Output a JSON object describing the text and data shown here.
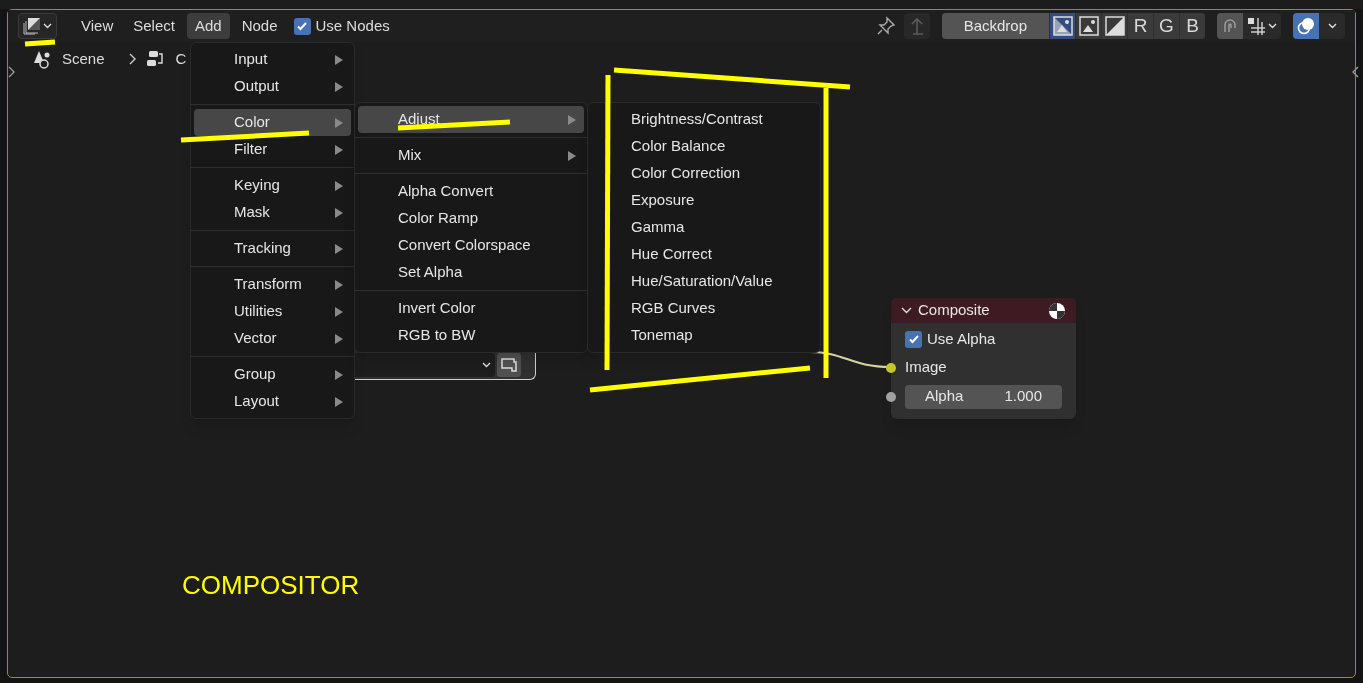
{
  "header": {
    "menus": [
      {
        "label": "View",
        "selected": false
      },
      {
        "label": "Select",
        "selected": false
      },
      {
        "label": "Add",
        "selected": true
      },
      {
        "label": "Node",
        "selected": false
      }
    ],
    "use_nodes": {
      "label": "Use Nodes",
      "checked": true
    },
    "backdrop": {
      "label": "Backdrop",
      "modes": [
        {
          "kind": "color_alpha",
          "selected": true
        },
        {
          "kind": "color",
          "selected": false
        },
        {
          "kind": "alpha",
          "selected": false
        },
        {
          "kind": "channel",
          "label": "R",
          "selected": false
        },
        {
          "kind": "channel",
          "label": "G",
          "selected": false
        },
        {
          "kind": "channel",
          "label": "B",
          "selected": false
        }
      ]
    },
    "snap": {
      "on": true
    },
    "overlays": {
      "on": true
    }
  },
  "breadcrumb": [
    "Scene",
    "C"
  ],
  "add_menu": [
    [
      {
        "label": "Input",
        "submenu": true,
        "selected": false
      },
      {
        "label": "Output",
        "submenu": true,
        "selected": false
      }
    ],
    [
      {
        "label": "Color",
        "submenu": true,
        "selected": true
      },
      {
        "label": "Filter",
        "submenu": true,
        "selected": false
      }
    ],
    [
      {
        "label": "Keying",
        "submenu": true,
        "selected": false
      },
      {
        "label": "Mask",
        "submenu": true,
        "selected": false
      }
    ],
    [
      {
        "label": "Tracking",
        "submenu": true,
        "selected": false
      }
    ],
    [
      {
        "label": "Transform",
        "submenu": true,
        "selected": false
      },
      {
        "label": "Utilities",
        "submenu": true,
        "selected": false
      },
      {
        "label": "Vector",
        "submenu": true,
        "selected": false
      }
    ],
    [
      {
        "label": "Group",
        "submenu": true,
        "selected": false
      },
      {
        "label": "Layout",
        "submenu": true,
        "selected": false
      }
    ]
  ],
  "color_menu": [
    [
      {
        "label": "Adjust",
        "submenu": true,
        "selected": true
      }
    ],
    [
      {
        "label": "Mix",
        "submenu": true,
        "selected": false
      }
    ],
    [
      {
        "label": "Alpha Convert",
        "submenu": false,
        "selected": false
      },
      {
        "label": "Color Ramp",
        "submenu": false,
        "selected": false
      },
      {
        "label": "Convert Colorspace",
        "submenu": false,
        "selected": false
      },
      {
        "label": "Set Alpha",
        "submenu": false,
        "selected": false
      }
    ],
    [
      {
        "label": "Invert Color",
        "submenu": false,
        "selected": false
      },
      {
        "label": "RGB to BW",
        "submenu": false,
        "selected": false
      }
    ]
  ],
  "adjust_menu": [
    [
      {
        "label": "Brightness/Contrast",
        "submenu": false,
        "selected": false
      },
      {
        "label": "Color Balance",
        "submenu": false,
        "selected": false
      },
      {
        "label": "Color Correction",
        "submenu": false,
        "selected": false
      },
      {
        "label": "Exposure",
        "submenu": false,
        "selected": false
      },
      {
        "label": "Gamma",
        "submenu": false,
        "selected": false
      },
      {
        "label": "Hue Correct",
        "submenu": false,
        "selected": false
      },
      {
        "label": "Hue/Saturation/Value",
        "submenu": false,
        "selected": false
      },
      {
        "label": "RGB Curves",
        "submenu": false,
        "selected": false
      },
      {
        "label": "Tonemap",
        "submenu": false,
        "selected": false
      }
    ]
  ],
  "composite_node": {
    "title": "Composite",
    "expanded": true,
    "use_alpha": {
      "label": "Use Alpha",
      "checked": true
    },
    "inputs": [
      {
        "kind": "socket",
        "label": "Image",
        "color": "#c7c729"
      },
      {
        "kind": "value",
        "label": "Alpha",
        "value": "1.000",
        "color": "#a1a1a1"
      }
    ]
  },
  "annotation": {
    "text": "COMPOSITOR"
  }
}
